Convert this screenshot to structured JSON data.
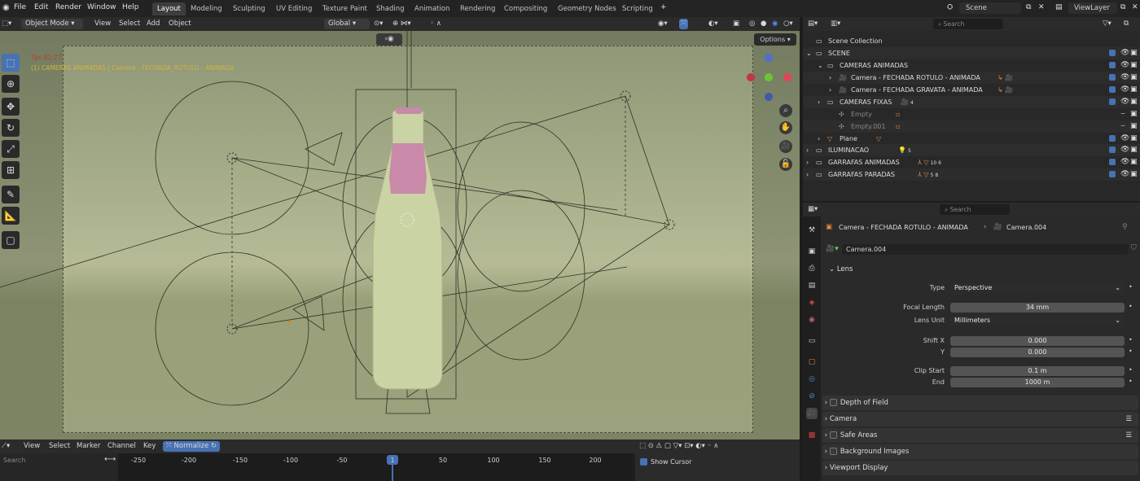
{
  "menu": {
    "file": "File",
    "edit": "Edit",
    "render": "Render",
    "window": "Window",
    "help": "Help"
  },
  "workspaces": [
    "Layout",
    "Modeling",
    "Sculpting",
    "UV Editing",
    "Texture Paint",
    "Shading",
    "Animation",
    "Rendering",
    "Compositing",
    "Geometry Nodes",
    "Scripting"
  ],
  "scene": {
    "label": "Scene",
    "viewlayer": "ViewLayer"
  },
  "viewport_header": {
    "mode": "Object Mode",
    "view": "View",
    "select": "Select",
    "add": "Add",
    "object": "Object",
    "orientation": "Global",
    "options": "Options"
  },
  "overlay_text": {
    "line1": "Tpc 01:27",
    "line2": "(1) CAMERAS ANIMADAS | Camera - FECHADA_ROTULO - ANIMADA"
  },
  "outliner": {
    "search_placeholder": "Search",
    "rows": [
      {
        "label": "Scene Collection"
      },
      {
        "label": "SCENE"
      },
      {
        "label": "CAMERAS ANIMADAS"
      },
      {
        "label": "Camera - FECHADA ROTULO - ANIMADA"
      },
      {
        "label": "Camera - FECHADA GRAVATA - ANIMADA"
      },
      {
        "label": "CAMERAS FIXAS",
        "count": "4"
      },
      {
        "label": "Empty"
      },
      {
        "label": "Empty.001"
      },
      {
        "label": "Plane"
      },
      {
        "label": "ILUMINACAO",
        "count": "5"
      },
      {
        "label": "GARRAFAS ANIMADAS",
        "counts": "10 6"
      },
      {
        "label": "GARRAFAS PARADAS",
        "counts": "5 8"
      }
    ]
  },
  "properties": {
    "search_placeholder": "Search",
    "breadcrumb_object": "Camera - FECHADA ROTULO - ANIMADA",
    "breadcrumb_data": "Camera.004",
    "datablock": "Camera.004",
    "lens_section": "Lens",
    "type_label": "Type",
    "type_value": "Perspective",
    "focal_label": "Focal Length",
    "focal_value": "34 mm",
    "unit_label": "Lens Unit",
    "unit_value": "Millimeters",
    "shiftx_label": "Shift X",
    "shiftx_value": "0.000",
    "shifty_label": "Y",
    "shifty_value": "0.000",
    "clipstart_label": "Clip Start",
    "clipstart_value": "0.1 m",
    "clipend_label": "End",
    "clipend_value": "1000 m",
    "sections": [
      "Depth of Field",
      "Camera",
      "Safe Areas",
      "Background Images",
      "Viewport Display"
    ]
  },
  "timeline": {
    "view": "View",
    "select": "Select",
    "marker": "Marker",
    "channel": "Channel",
    "key": "Key",
    "normalize": "Normalize",
    "search_placeholder": "Search",
    "ticks": [
      "-250",
      "-200",
      "-150",
      "-100",
      "-50",
      "1",
      "50",
      "100",
      "150",
      "200"
    ],
    "show_cursor": "Show Cursor"
  }
}
